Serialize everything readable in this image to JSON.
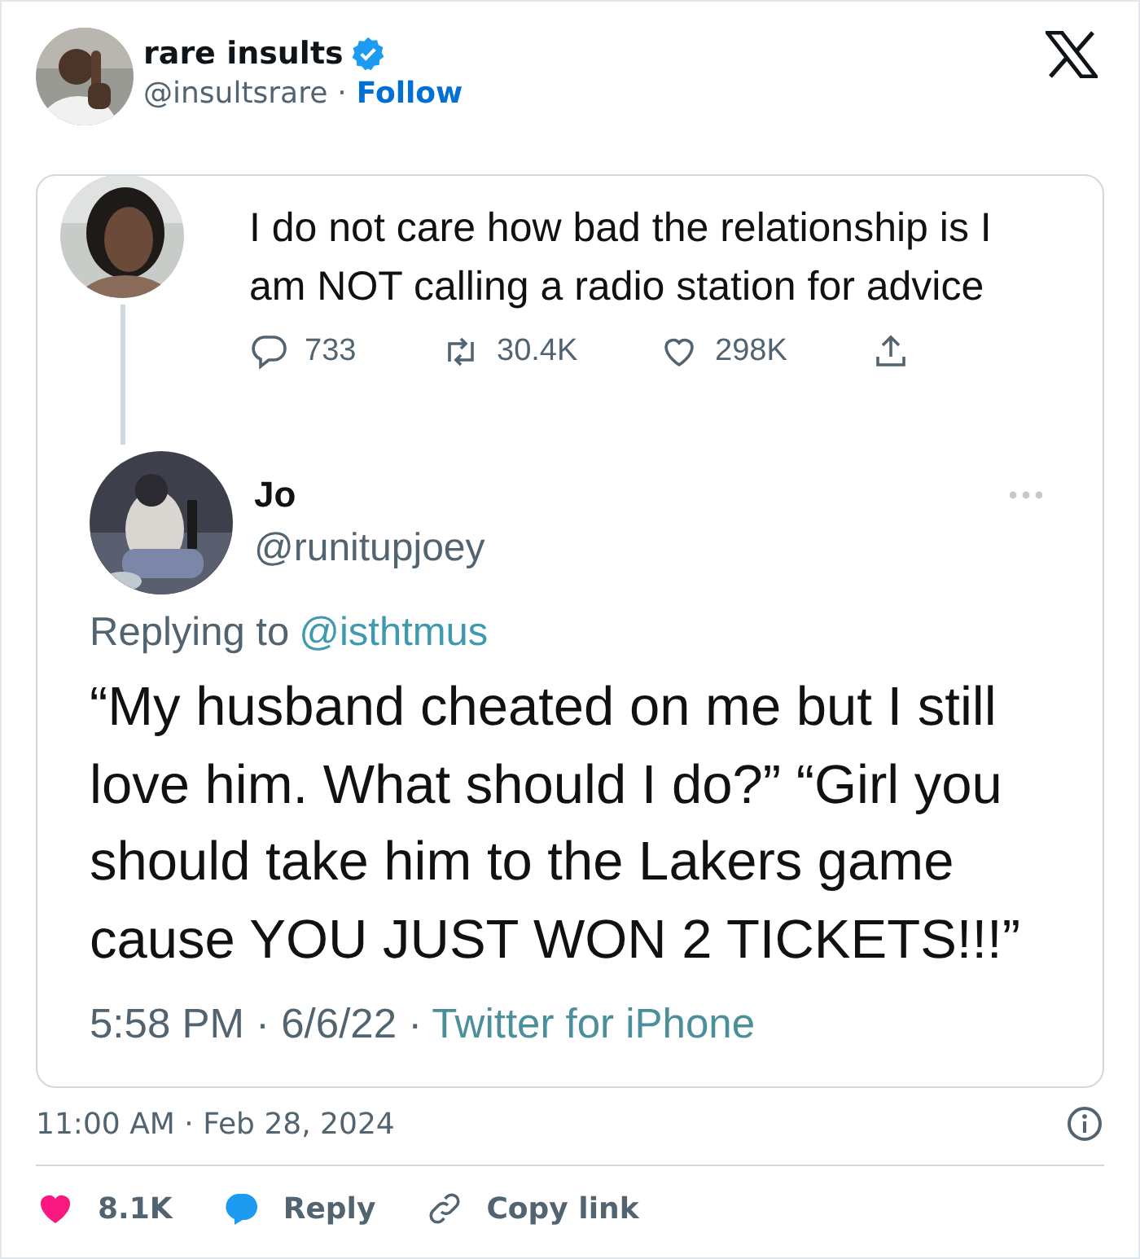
{
  "author": {
    "name": "rare insults",
    "verified": true,
    "handle": "@insultsrare",
    "separator": "·",
    "follow": "Follow"
  },
  "embedded_screenshot": {
    "original_tweet": {
      "text": "I do not care how bad the relationship is I am NOT calling a radio station for advice",
      "stats": [
        {
          "kind": "reply",
          "count": "733"
        },
        {
          "kind": "retweet",
          "count": "30.4K"
        },
        {
          "kind": "like",
          "count": "298K"
        },
        {
          "kind": "share"
        }
      ]
    },
    "reply_tweet": {
      "name": "Jo",
      "handle": "@runitupjoey",
      "replying_prefix": "Replying to",
      "replying_handle": "@isthtmus",
      "text": "“My husband cheated on me but I still love him. What should I do?” “Girl you should take him to the Lakers game cause YOU JUST WON 2 TICKETS!!!”",
      "time": "5:58 PM · 6/6/22 ·",
      "source": "Twitter for iPhone"
    }
  },
  "timestamp": "11:00 AM · Feb 28, 2024",
  "actions": [
    {
      "kind": "like",
      "label": "8.1K"
    },
    {
      "kind": "reply",
      "label": "Reply"
    },
    {
      "kind": "copy_link",
      "label": "Copy link"
    }
  ]
}
